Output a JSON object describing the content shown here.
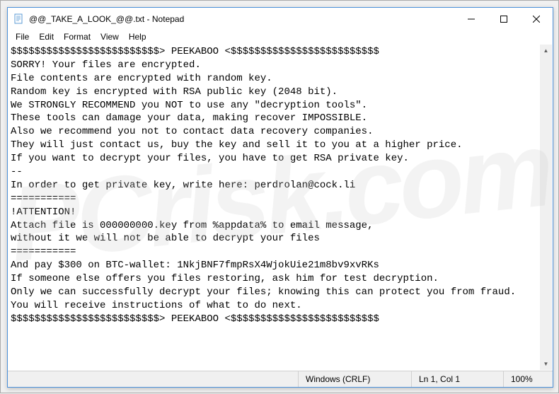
{
  "window": {
    "title": "@@_TAKE_A_LOOK_@@.txt - Notepad"
  },
  "menubar": {
    "items": [
      "File",
      "Edit",
      "Format",
      "View",
      "Help"
    ]
  },
  "content": {
    "text": "$$$$$$$$$$$$$$$$$$$$$$$$$> PEEKABOO <$$$$$$$$$$$$$$$$$$$$$$$$$\nSORRY! Your files are encrypted.\nFile contents are encrypted with random key.\nRandom key is encrypted with RSA public key (2048 bit).\nWe STRONGLY RECOMMEND you NOT to use any \"decryption tools\".\nThese tools can damage your data, making recover IMPOSSIBLE.\nAlso we recommend you not to contact data recovery companies.\nThey will just contact us, buy the key and sell it to you at a higher price.\nIf you want to decrypt your files, you have to get RSA private key.\n--\nIn order to get private key, write here: perdrolan@cock.li\n===========\n!ATTENTION!\nAttach file is 000000000.key from %appdata% to email message,\nwithout it we will not be able to decrypt your files\n===========\nAnd pay $300 on BTC-wallet: 1NkjBNF7fmpRsX4WjokUie21m8bv9xvRKs\nIf someone else offers you files restoring, ask him for test decryption.\nOnly we can successfully decrypt your files; knowing this can protect you from fraud.\nYou will receive instructions of what to do next.\n$$$$$$$$$$$$$$$$$$$$$$$$$> PEEKABOO <$$$$$$$$$$$$$$$$$$$$$$$$$"
  },
  "statusbar": {
    "encoding": "Windows (CRLF)",
    "position": "Ln 1, Col 1",
    "zoom": "100%"
  },
  "watermark": "PCrisk.com"
}
